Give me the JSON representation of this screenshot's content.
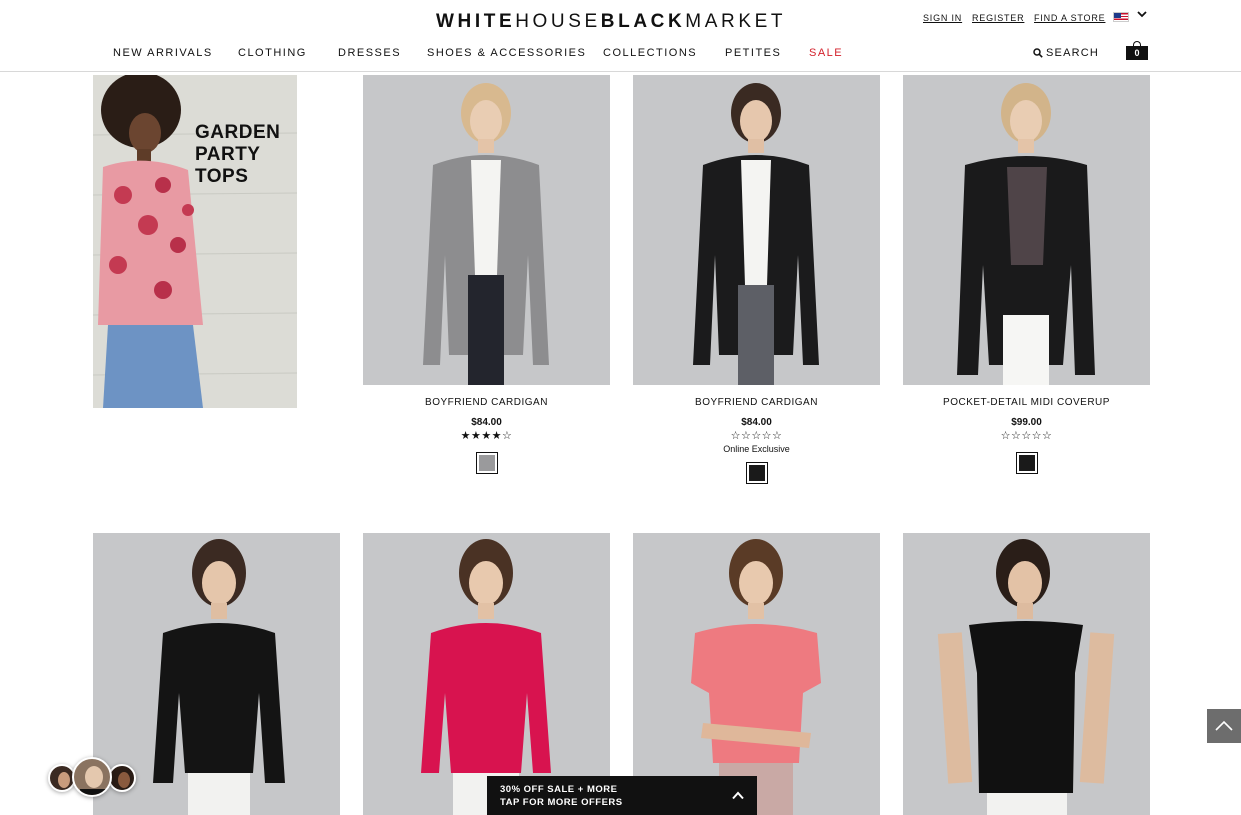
{
  "header": {
    "logo": {
      "part1": "WHITE",
      "part2": "HOUSE",
      "part3": "BLACK",
      "part4": "MARKET"
    },
    "utility": {
      "sign_in": "SIGN IN",
      "register": "REGISTER",
      "find_store": "FIND A STORE",
      "country_flag_icon": "us-flag-icon"
    },
    "nav": [
      "NEW ARRIVALS",
      "CLOTHING",
      "DRESSES",
      "SHOES & ACCESSORIES",
      "COLLECTIONS",
      "PETITES",
      "SALE"
    ],
    "search_label": "SEARCH",
    "bag_count": "0"
  },
  "colors": {
    "sale_red": "#d31f2a",
    "black": "#111111",
    "bg_gray": "#c6c7c9"
  },
  "promo": {
    "text": "GARDEN\nPARTY\nTOPS"
  },
  "products": [
    {
      "name": "BOYFRIEND CARDIGAN",
      "price": "$84.00",
      "rating": 4,
      "stars_text": "★★★★☆",
      "exclusive": "",
      "swatch_color": "#9a9a9c"
    },
    {
      "name": "BOYFRIEND CARDIGAN",
      "price": "$84.00",
      "rating": 0,
      "stars_text": "☆☆☆☆☆",
      "exclusive": "Online Exclusive",
      "swatch_color": "#1a1a1a"
    },
    {
      "name": "POCKET-DETAIL MIDI COVERUP",
      "price": "$99.00",
      "rating": 0,
      "stars_text": "☆☆☆☆☆",
      "exclusive": "",
      "swatch_color": "#1a1a1a"
    }
  ],
  "offer": {
    "line1": "30% OFF SALE + MORE",
    "line2": "TAP FOR MORE OFFERS"
  }
}
